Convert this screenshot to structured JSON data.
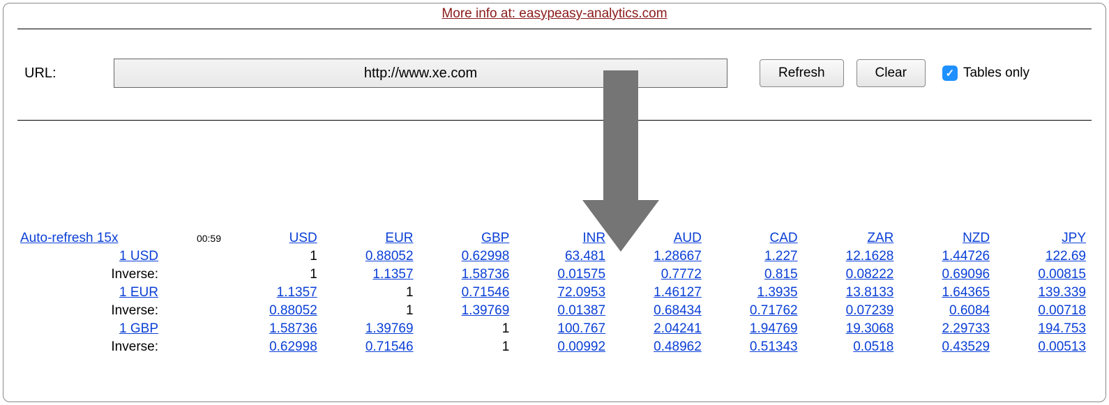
{
  "info_link": "More info at: easypeasy-analytics.com",
  "url": {
    "label": "URL:",
    "value": "http://www.xe.com",
    "refresh": "Refresh",
    "clear": "Clear",
    "tables_only": "Tables only"
  },
  "auto_refresh": "Auto-refresh 15x",
  "timer": "00:59",
  "columns": [
    "USD",
    "EUR",
    "GBP",
    "INR",
    "AUD",
    "CAD",
    "ZAR",
    "NZD",
    "JPY"
  ],
  "rows": [
    {
      "label": "1 USD",
      "values": [
        "1",
        "0.88052",
        "0.62998",
        "63.481",
        "1.28667",
        "1.227",
        "12.1628",
        "1.44726",
        "122.69"
      ]
    },
    {
      "label": "Inverse:",
      "inverse": true,
      "values": [
        "1",
        "1.1357",
        "1.58736",
        "0.01575",
        "0.7772",
        "0.815",
        "0.08222",
        "0.69096",
        "0.00815"
      ]
    },
    {
      "label": "1 EUR",
      "values": [
        "1.1357",
        "1",
        "0.71546",
        "72.0953",
        "1.46127",
        "1.3935",
        "13.8133",
        "1.64365",
        "139.339"
      ]
    },
    {
      "label": "Inverse:",
      "inverse": true,
      "values": [
        "0.88052",
        "1",
        "1.39769",
        "0.01387",
        "0.68434",
        "0.71762",
        "0.07239",
        "0.6084",
        "0.00718"
      ]
    },
    {
      "label": "1 GBP",
      "values": [
        "1.58736",
        "1.39769",
        "1",
        "100.767",
        "2.04241",
        "1.94769",
        "19.3068",
        "2.29733",
        "194.753"
      ]
    },
    {
      "label": "Inverse:",
      "inverse": true,
      "values": [
        "0.62998",
        "0.71546",
        "1",
        "0.00992",
        "0.48962",
        "0.51343",
        "0.0518",
        "0.43529",
        "0.00513"
      ]
    }
  ]
}
